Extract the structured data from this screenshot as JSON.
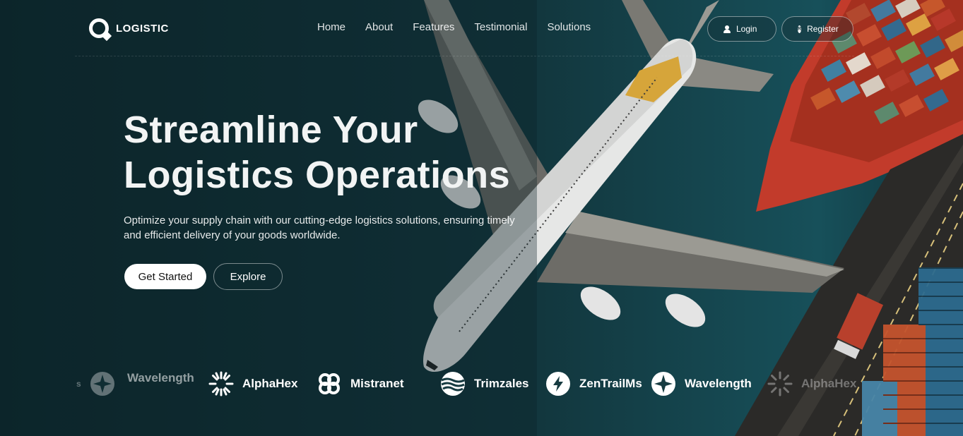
{
  "nav": {
    "logo_text": "LOGISTIC",
    "menu": [
      "Home",
      "About",
      "Features",
      "Testimonial",
      "Solutions"
    ],
    "login_label": "Login",
    "register_label": "Register"
  },
  "hero": {
    "headline_line1": "Streamline Your",
    "headline_line2": "Logistics Operations",
    "subtitle": "Optimize your supply chain with our cutting-edge logistics solutions, ensuring timely and efficient delivery of your goods worldwide.",
    "primary_button": "Get Started",
    "secondary_button": "Explore"
  },
  "brands": [
    {
      "name": "s",
      "icon": "star-circle-icon"
    },
    {
      "name": "Wavelength",
      "icon": "star-circle-icon"
    },
    {
      "name": "AlphaHex",
      "icon": "sunburst-icon"
    },
    {
      "name": "Mistranet",
      "icon": "clover-icon"
    },
    {
      "name": "Trimzales",
      "icon": "waves-circle-icon"
    },
    {
      "name": "ZenTrailMs",
      "icon": "bolt-circle-icon"
    },
    {
      "name": "Wavelength",
      "icon": "star-circle-icon"
    },
    {
      "name": "AlphaHex",
      "icon": "sunburst-icon"
    }
  ],
  "colors": {
    "background": "#0f2d33",
    "ship_hull": "#c8402e",
    "white": "#ffffff"
  }
}
